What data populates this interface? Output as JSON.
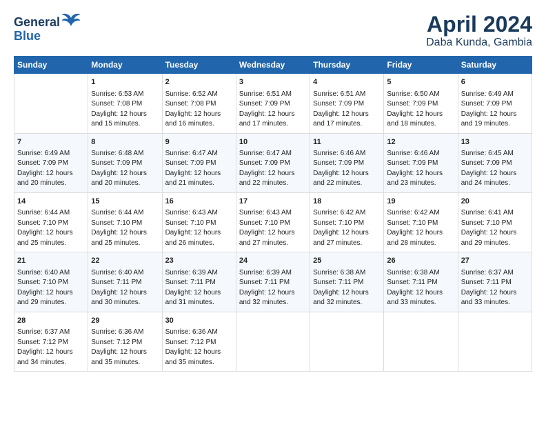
{
  "header": {
    "logo_line1": "General",
    "logo_line2": "Blue",
    "title": "April 2024",
    "subtitle": "Daba Kunda, Gambia"
  },
  "columns": [
    "Sunday",
    "Monday",
    "Tuesday",
    "Wednesday",
    "Thursday",
    "Friday",
    "Saturday"
  ],
  "weeks": [
    [
      {
        "day": "",
        "lines": []
      },
      {
        "day": "1",
        "lines": [
          "Sunrise: 6:53 AM",
          "Sunset: 7:08 PM",
          "Daylight: 12 hours",
          "and 15 minutes."
        ]
      },
      {
        "day": "2",
        "lines": [
          "Sunrise: 6:52 AM",
          "Sunset: 7:08 PM",
          "Daylight: 12 hours",
          "and 16 minutes."
        ]
      },
      {
        "day": "3",
        "lines": [
          "Sunrise: 6:51 AM",
          "Sunset: 7:09 PM",
          "Daylight: 12 hours",
          "and 17 minutes."
        ]
      },
      {
        "day": "4",
        "lines": [
          "Sunrise: 6:51 AM",
          "Sunset: 7:09 PM",
          "Daylight: 12 hours",
          "and 17 minutes."
        ]
      },
      {
        "day": "5",
        "lines": [
          "Sunrise: 6:50 AM",
          "Sunset: 7:09 PM",
          "Daylight: 12 hours",
          "and 18 minutes."
        ]
      },
      {
        "day": "6",
        "lines": [
          "Sunrise: 6:49 AM",
          "Sunset: 7:09 PM",
          "Daylight: 12 hours",
          "and 19 minutes."
        ]
      }
    ],
    [
      {
        "day": "7",
        "lines": [
          "Sunrise: 6:49 AM",
          "Sunset: 7:09 PM",
          "Daylight: 12 hours",
          "and 20 minutes."
        ]
      },
      {
        "day": "8",
        "lines": [
          "Sunrise: 6:48 AM",
          "Sunset: 7:09 PM",
          "Daylight: 12 hours",
          "and 20 minutes."
        ]
      },
      {
        "day": "9",
        "lines": [
          "Sunrise: 6:47 AM",
          "Sunset: 7:09 PM",
          "Daylight: 12 hours",
          "and 21 minutes."
        ]
      },
      {
        "day": "10",
        "lines": [
          "Sunrise: 6:47 AM",
          "Sunset: 7:09 PM",
          "Daylight: 12 hours",
          "and 22 minutes."
        ]
      },
      {
        "day": "11",
        "lines": [
          "Sunrise: 6:46 AM",
          "Sunset: 7:09 PM",
          "Daylight: 12 hours",
          "and 22 minutes."
        ]
      },
      {
        "day": "12",
        "lines": [
          "Sunrise: 6:46 AM",
          "Sunset: 7:09 PM",
          "Daylight: 12 hours",
          "and 23 minutes."
        ]
      },
      {
        "day": "13",
        "lines": [
          "Sunrise: 6:45 AM",
          "Sunset: 7:09 PM",
          "Daylight: 12 hours",
          "and 24 minutes."
        ]
      }
    ],
    [
      {
        "day": "14",
        "lines": [
          "Sunrise: 6:44 AM",
          "Sunset: 7:10 PM",
          "Daylight: 12 hours",
          "and 25 minutes."
        ]
      },
      {
        "day": "15",
        "lines": [
          "Sunrise: 6:44 AM",
          "Sunset: 7:10 PM",
          "Daylight: 12 hours",
          "and 25 minutes."
        ]
      },
      {
        "day": "16",
        "lines": [
          "Sunrise: 6:43 AM",
          "Sunset: 7:10 PM",
          "Daylight: 12 hours",
          "and 26 minutes."
        ]
      },
      {
        "day": "17",
        "lines": [
          "Sunrise: 6:43 AM",
          "Sunset: 7:10 PM",
          "Daylight: 12 hours",
          "and 27 minutes."
        ]
      },
      {
        "day": "18",
        "lines": [
          "Sunrise: 6:42 AM",
          "Sunset: 7:10 PM",
          "Daylight: 12 hours",
          "and 27 minutes."
        ]
      },
      {
        "day": "19",
        "lines": [
          "Sunrise: 6:42 AM",
          "Sunset: 7:10 PM",
          "Daylight: 12 hours",
          "and 28 minutes."
        ]
      },
      {
        "day": "20",
        "lines": [
          "Sunrise: 6:41 AM",
          "Sunset: 7:10 PM",
          "Daylight: 12 hours",
          "and 29 minutes."
        ]
      }
    ],
    [
      {
        "day": "21",
        "lines": [
          "Sunrise: 6:40 AM",
          "Sunset: 7:10 PM",
          "Daylight: 12 hours",
          "and 29 minutes."
        ]
      },
      {
        "day": "22",
        "lines": [
          "Sunrise: 6:40 AM",
          "Sunset: 7:11 PM",
          "Daylight: 12 hours",
          "and 30 minutes."
        ]
      },
      {
        "day": "23",
        "lines": [
          "Sunrise: 6:39 AM",
          "Sunset: 7:11 PM",
          "Daylight: 12 hours",
          "and 31 minutes."
        ]
      },
      {
        "day": "24",
        "lines": [
          "Sunrise: 6:39 AM",
          "Sunset: 7:11 PM",
          "Daylight: 12 hours",
          "and 32 minutes."
        ]
      },
      {
        "day": "25",
        "lines": [
          "Sunrise: 6:38 AM",
          "Sunset: 7:11 PM",
          "Daylight: 12 hours",
          "and 32 minutes."
        ]
      },
      {
        "day": "26",
        "lines": [
          "Sunrise: 6:38 AM",
          "Sunset: 7:11 PM",
          "Daylight: 12 hours",
          "and 33 minutes."
        ]
      },
      {
        "day": "27",
        "lines": [
          "Sunrise: 6:37 AM",
          "Sunset: 7:11 PM",
          "Daylight: 12 hours",
          "and 33 minutes."
        ]
      }
    ],
    [
      {
        "day": "28",
        "lines": [
          "Sunrise: 6:37 AM",
          "Sunset: 7:12 PM",
          "Daylight: 12 hours",
          "and 34 minutes."
        ]
      },
      {
        "day": "29",
        "lines": [
          "Sunrise: 6:36 AM",
          "Sunset: 7:12 PM",
          "Daylight: 12 hours",
          "and 35 minutes."
        ]
      },
      {
        "day": "30",
        "lines": [
          "Sunrise: 6:36 AM",
          "Sunset: 7:12 PM",
          "Daylight: 12 hours",
          "and 35 minutes."
        ]
      },
      {
        "day": "",
        "lines": []
      },
      {
        "day": "",
        "lines": []
      },
      {
        "day": "",
        "lines": []
      },
      {
        "day": "",
        "lines": []
      }
    ]
  ]
}
